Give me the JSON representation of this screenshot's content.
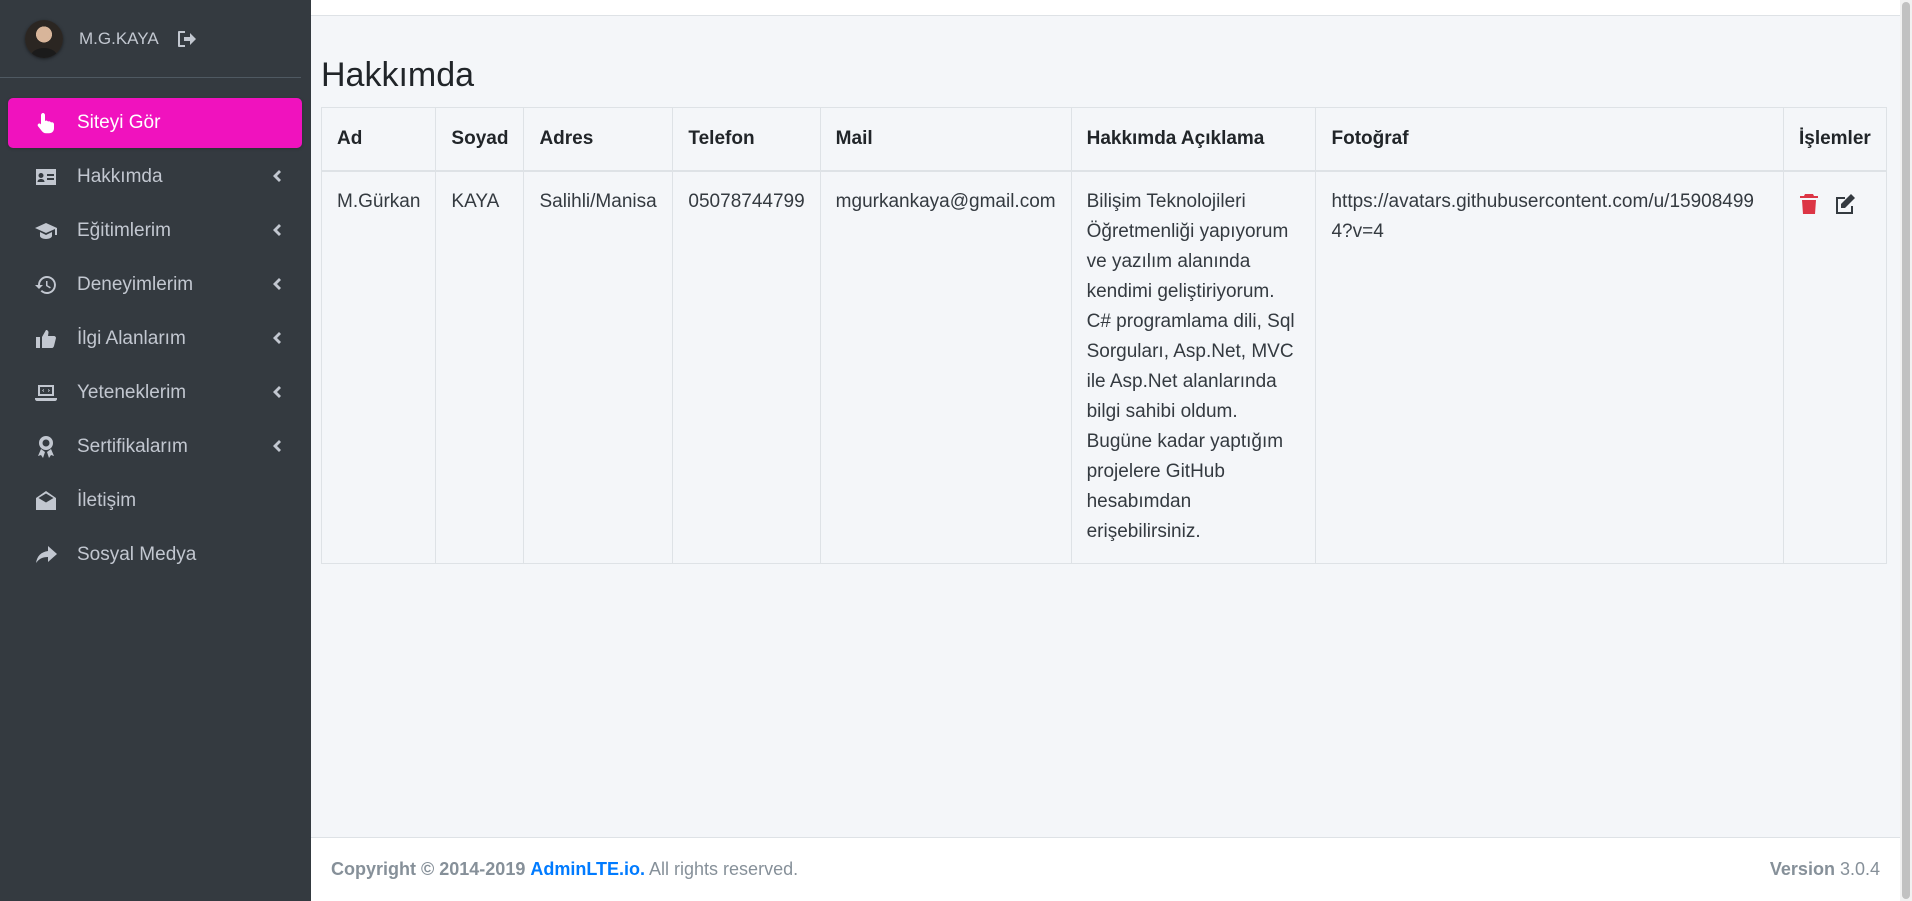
{
  "user": {
    "name": "M.G.KAYA"
  },
  "nav": [
    {
      "label": "Siteyi Gör",
      "icon": "pointer-hand-icon",
      "active": true
    },
    {
      "label": "Hakkımda",
      "icon": "id-card-icon"
    },
    {
      "label": "Eğitimlerim",
      "icon": "graduation-cap-icon"
    },
    {
      "label": "Deneyimlerim",
      "icon": "history-icon"
    },
    {
      "label": "İlgi Alanlarım",
      "icon": "thumbs-up-icon"
    },
    {
      "label": "Yeteneklerim",
      "icon": "laptop-code-icon"
    },
    {
      "label": "Sertifikalarım",
      "icon": "award-icon"
    },
    {
      "label": "İletişim",
      "icon": "envelope-open-icon"
    },
    {
      "label": "Sosyal Medya",
      "icon": "share-icon"
    }
  ],
  "page": {
    "title": "Hakkımda"
  },
  "table": {
    "headers": [
      "Ad",
      "Soyad",
      "Adres",
      "Telefon",
      "Mail",
      "Hakkımda Açıklama",
      "Fotoğraf",
      "İşlemler"
    ],
    "rows": [
      {
        "ad": "M.Gürkan",
        "soyad": "KAYA",
        "adres": "Salihli/Manisa",
        "telefon": "05078744799",
        "mail": "mgurkankaya@gmail.com",
        "aciklama": "Bilişim Teknolojileri Öğretmenliği yapıyorum ve yazılım alanında kendimi geliştiriyorum. C# programlama dili, Sql Sorguları, Asp.Net, MVC ile Asp.Net alanlarında bilgi sahibi oldum. Bugüne kadar yaptığım projelere GitHub hesabımdan erişebilirsiniz.",
        "fotograf": "https://avatars.githubusercontent.com/u/159084994?v=4"
      }
    ]
  },
  "footer": {
    "copyright": "Copyright © 2014-2019",
    "link": "AdminLTE.io.",
    "rights": "All rights reserved.",
    "version_label": "Version",
    "version": "3.0.4"
  },
  "colors": {
    "accent": "#f012be",
    "sidebar": "#343a40",
    "danger": "#dc3545",
    "link": "#007bff"
  }
}
